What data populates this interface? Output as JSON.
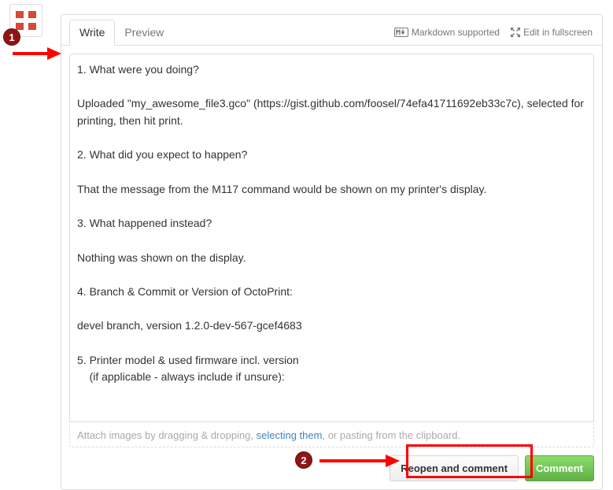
{
  "tabs": {
    "write": "Write",
    "preview": "Preview"
  },
  "toolbar": {
    "markdown": "Markdown supported",
    "fullscreen": "Edit in fullscreen"
  },
  "comment": {
    "text": "1. What were you doing?\n\nUploaded \"my_awesome_file3.gco\" (https://gist.github.com/foosel/74efa41711692eb33c7c), selected for printing, then hit print.\n\n2. What did you expect to happen?\n\nThat the message from the M117 command would be shown on my printer's display.\n\n3. What happened instead?\n\nNothing was shown on the display.\n\n4. Branch & Commit or Version of OctoPrint:\n\ndevel branch, version 1.2.0-dev-567-gcef4683\n\n5. Printer model & used firmware incl. version\n    (if applicable - always include if unsure):\n\n"
  },
  "attach": {
    "prefix": "Attach images by dragging & dropping, ",
    "link": "selecting them",
    "suffix": ", or pasting from the clipboard."
  },
  "actions": {
    "reopen": "Reopen and comment",
    "comment": "Comment"
  },
  "annotations": {
    "step1": "1",
    "step2": "2"
  }
}
